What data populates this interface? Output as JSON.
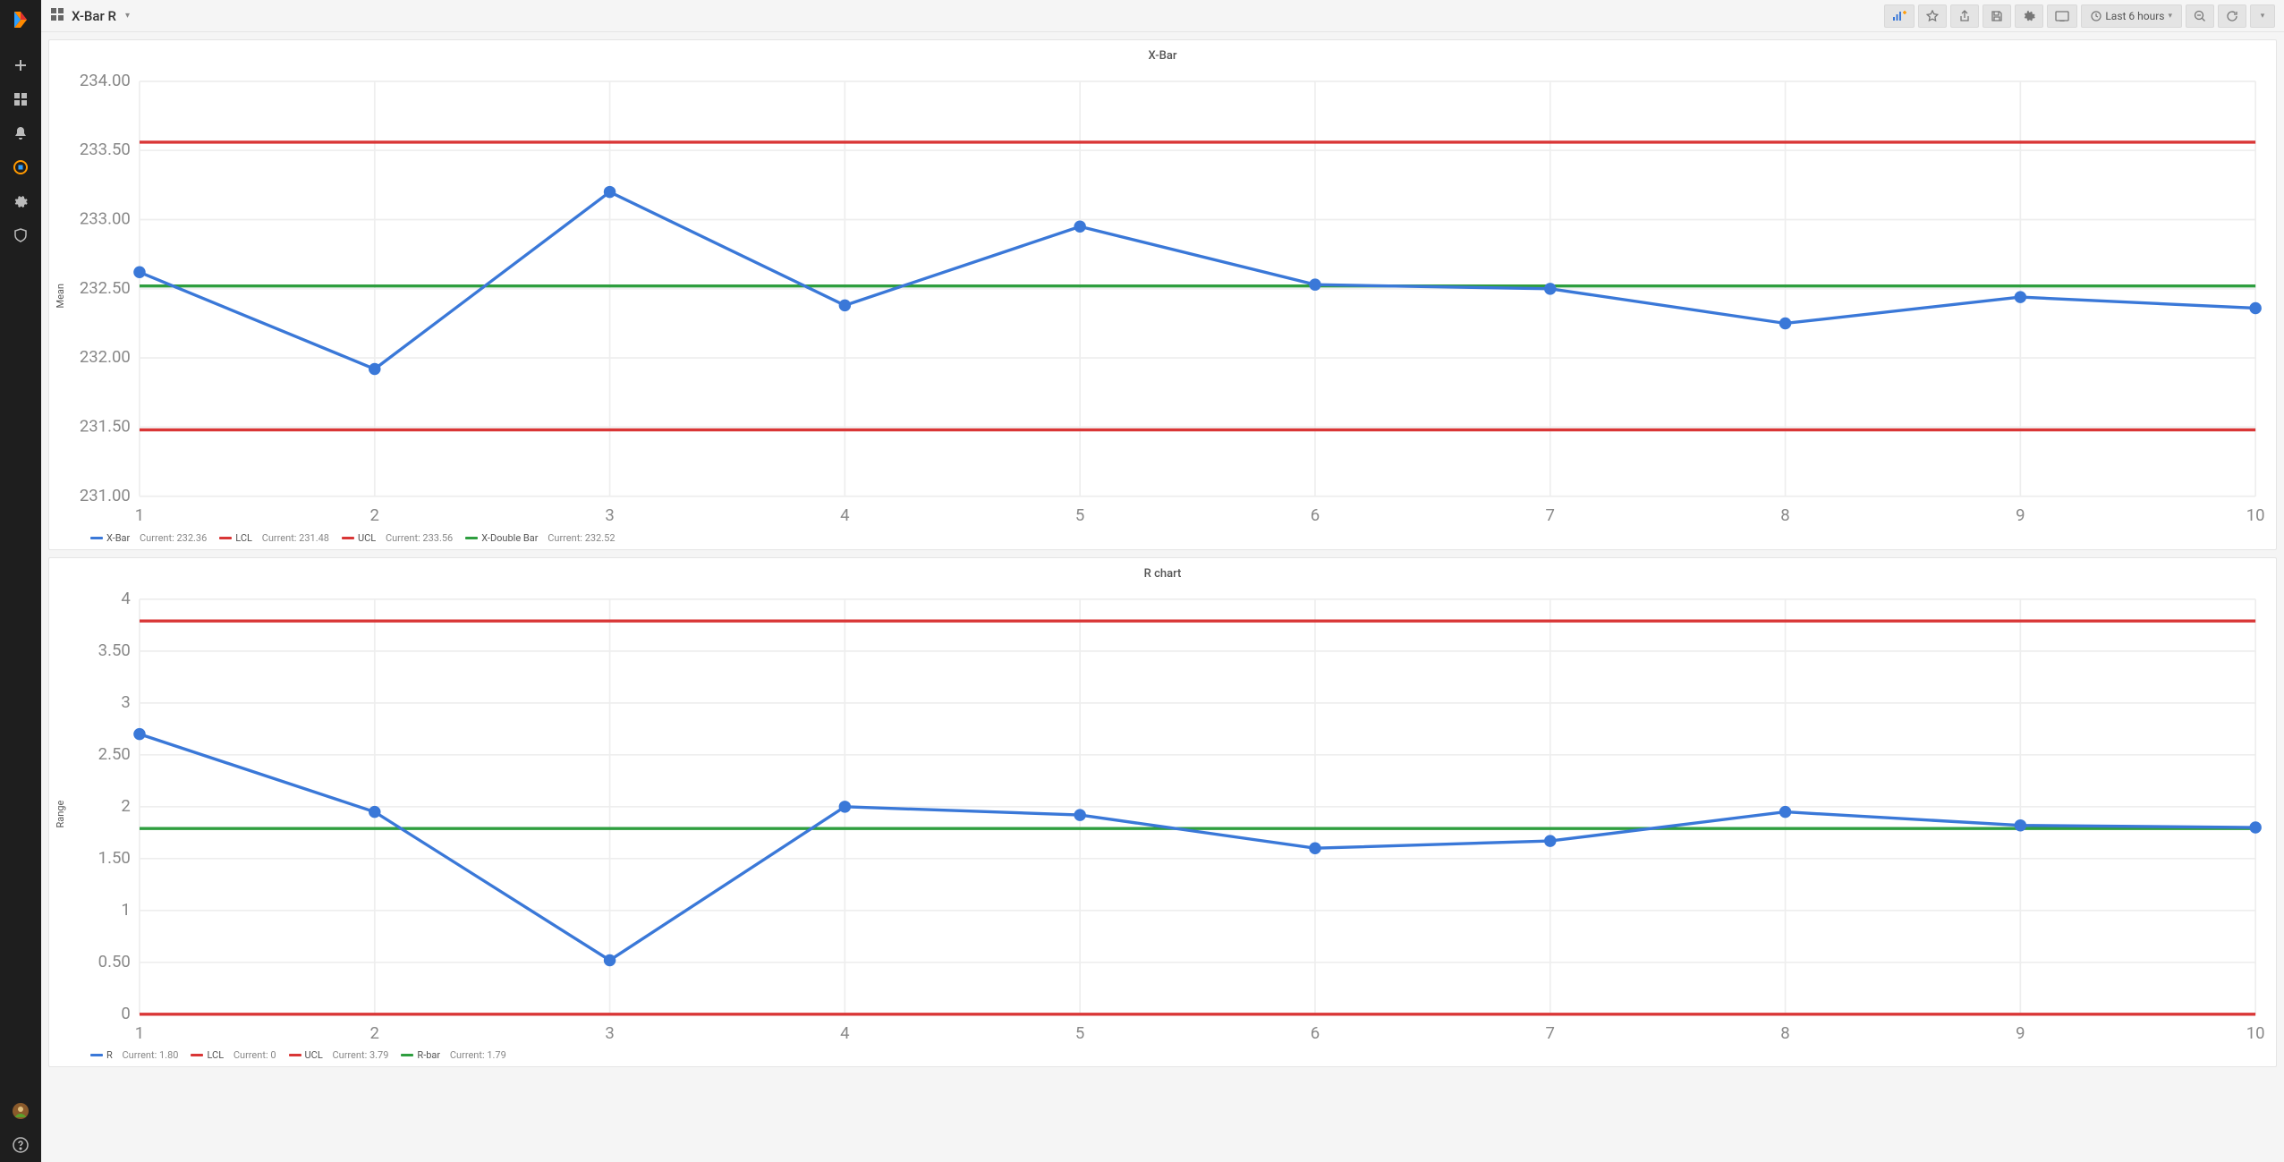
{
  "header": {
    "title": "X-Bar R",
    "time_range": "Last 6 hours"
  },
  "charts": {
    "xbar": {
      "title": "X-Bar",
      "ylabel": "Mean",
      "legend": [
        {
          "color": "#3a78d8",
          "label": "X-Bar",
          "current": "232.36"
        },
        {
          "color": "#d93636",
          "label": "LCL",
          "current": "231.48"
        },
        {
          "color": "#d93636",
          "label": "UCL",
          "current": "233.56"
        },
        {
          "color": "#2e9e3f",
          "label": "X-Double Bar",
          "current": "232.52"
        }
      ]
    },
    "rchart": {
      "title": "R chart",
      "ylabel": "Range",
      "legend": [
        {
          "color": "#3a78d8",
          "label": "R",
          "current": "1.80"
        },
        {
          "color": "#d93636",
          "label": "LCL",
          "current": "0"
        },
        {
          "color": "#d93636",
          "label": "UCL",
          "current": "3.79"
        },
        {
          "color": "#2e9e3f",
          "label": "R-bar",
          "current": "1.79"
        }
      ]
    }
  },
  "chart_data": [
    {
      "type": "line",
      "title": "X-Bar",
      "xlabel": "",
      "ylabel": "Mean",
      "x": [
        1,
        2,
        3,
        4,
        5,
        6,
        7,
        8,
        9,
        10
      ],
      "ylim": [
        231.0,
        234.0
      ],
      "yticks": [
        231.0,
        231.5,
        232.0,
        232.5,
        233.0,
        233.5,
        234.0
      ],
      "series": [
        {
          "name": "X-Bar",
          "color": "#3a78d8",
          "values": [
            232.62,
            231.92,
            233.2,
            232.38,
            232.95,
            232.53,
            232.5,
            232.25,
            232.44,
            232.36
          ]
        },
        {
          "name": "LCL",
          "color": "#d93636",
          "constant": 231.48
        },
        {
          "name": "UCL",
          "color": "#d93636",
          "constant": 233.56
        },
        {
          "name": "X-Double Bar",
          "color": "#2e9e3f",
          "constant": 232.52
        }
      ]
    },
    {
      "type": "line",
      "title": "R chart",
      "xlabel": "",
      "ylabel": "Range",
      "x": [
        1,
        2,
        3,
        4,
        5,
        6,
        7,
        8,
        9,
        10
      ],
      "ylim": [
        0,
        4.0
      ],
      "yticks": [
        0,
        0.5,
        1.0,
        1.5,
        2.0,
        2.5,
        3.0,
        3.5,
        4.0
      ],
      "series": [
        {
          "name": "R",
          "color": "#3a78d8",
          "values": [
            2.7,
            1.95,
            0.52,
            2.0,
            1.92,
            1.6,
            1.67,
            1.95,
            1.82,
            1.8
          ]
        },
        {
          "name": "LCL",
          "color": "#d93636",
          "constant": 0
        },
        {
          "name": "UCL",
          "color": "#d93636",
          "constant": 3.79
        },
        {
          "name": "R-bar",
          "color": "#2e9e3f",
          "constant": 1.79
        }
      ]
    }
  ]
}
